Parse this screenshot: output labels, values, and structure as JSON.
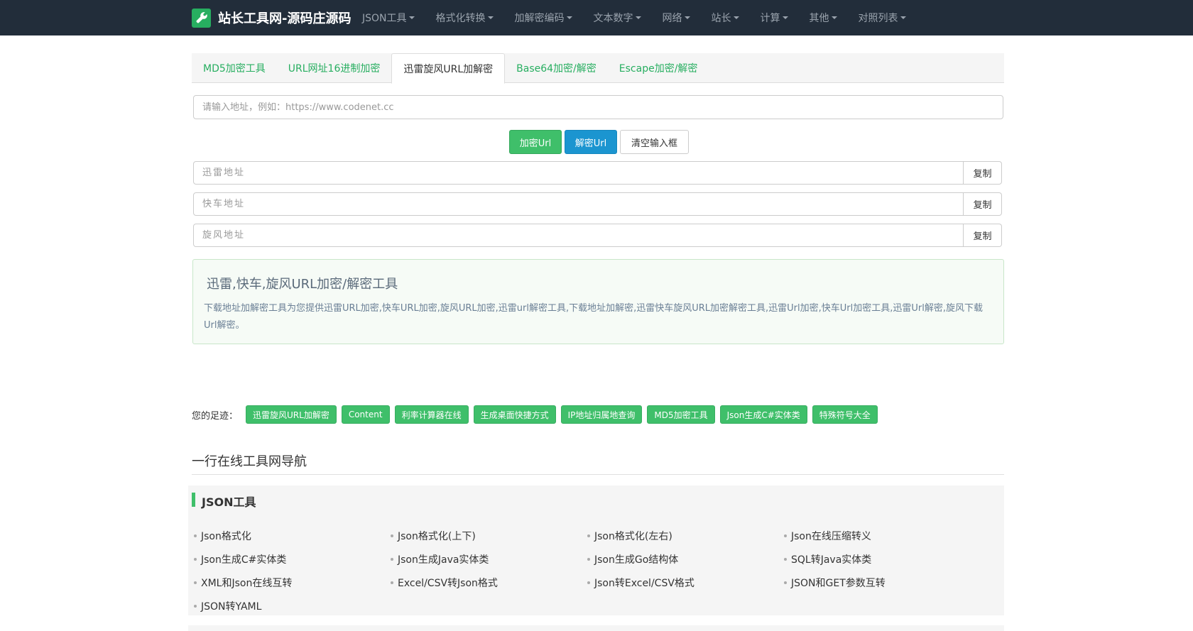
{
  "navbar": {
    "brand": "站长工具网-源码庄源码",
    "logo_icon": "wrench-icon",
    "menu": [
      {
        "label": "JSON工具"
      },
      {
        "label": "格式化转换"
      },
      {
        "label": "加解密编码"
      },
      {
        "label": "文本数字"
      },
      {
        "label": "网络"
      },
      {
        "label": "站长"
      },
      {
        "label": "计算"
      },
      {
        "label": "其他"
      },
      {
        "label": "对照列表"
      }
    ]
  },
  "tabs": [
    {
      "label": "MD5加密工具",
      "active": false
    },
    {
      "label": "URL网址16进制加密",
      "active": false
    },
    {
      "label": "迅雷旋风URL加解密",
      "active": true
    },
    {
      "label": "Base64加密/解密",
      "active": false
    },
    {
      "label": "Escape加密/解密",
      "active": false
    }
  ],
  "url_input": {
    "placeholder": "请输入地址，例如：https://www.codenet.cc",
    "value": ""
  },
  "actions": {
    "encrypt_label": "加密Url",
    "decrypt_label": "解密Url",
    "clear_label": "清空输入框"
  },
  "outputs": [
    {
      "placeholder": "迅雷地址",
      "copy_label": "复制"
    },
    {
      "placeholder": "快车地址",
      "copy_label": "复制"
    },
    {
      "placeholder": "旋风地址",
      "copy_label": "复制"
    }
  ],
  "info": {
    "title": "迅雷,快车,旋风URL加密/解密工具",
    "description": "下载地址加解密工具为您提供迅雷URL加密,快车URL加密,旋风URL加密,迅雷url解密工具,下载地址加解密,迅雷快车旋风URL加密解密工具,迅雷Url加密,快车Url加密工具,迅雷Url解密,旋风下载Url解密。"
  },
  "footprint": {
    "label": "您的足迹：",
    "tags": [
      "迅雷旋风URL加解密",
      "Content",
      "利率计算器在线",
      "生成桌面快捷方式",
      "IP地址归属地查询",
      "MD5加密工具",
      "Json生成C#实体类",
      "特殊符号大全"
    ]
  },
  "navigation": {
    "heading": "一行在线工具网导航",
    "json_section": {
      "title": "JSON工具",
      "links": [
        "Json格式化",
        " Json格式化(上下)",
        "Json格式化(左右)",
        "Json在线压缩转义",
        "Json生成C#实体类",
        " Json生成Java实体类",
        "Json生成Go结构体",
        "SQL转Java实体类",
        "XML和Json在线互转",
        "Excel/CSV转Json格式",
        "Json转Excel/CSV格式",
        "JSON和GET参数互转",
        "JSON转YAML"
      ]
    }
  },
  "colors": {
    "navbar_bg": "#222d3a",
    "accent_green": "#3fbf6a",
    "accent_blue": "#1b95d0",
    "link_green": "#27ae60"
  }
}
